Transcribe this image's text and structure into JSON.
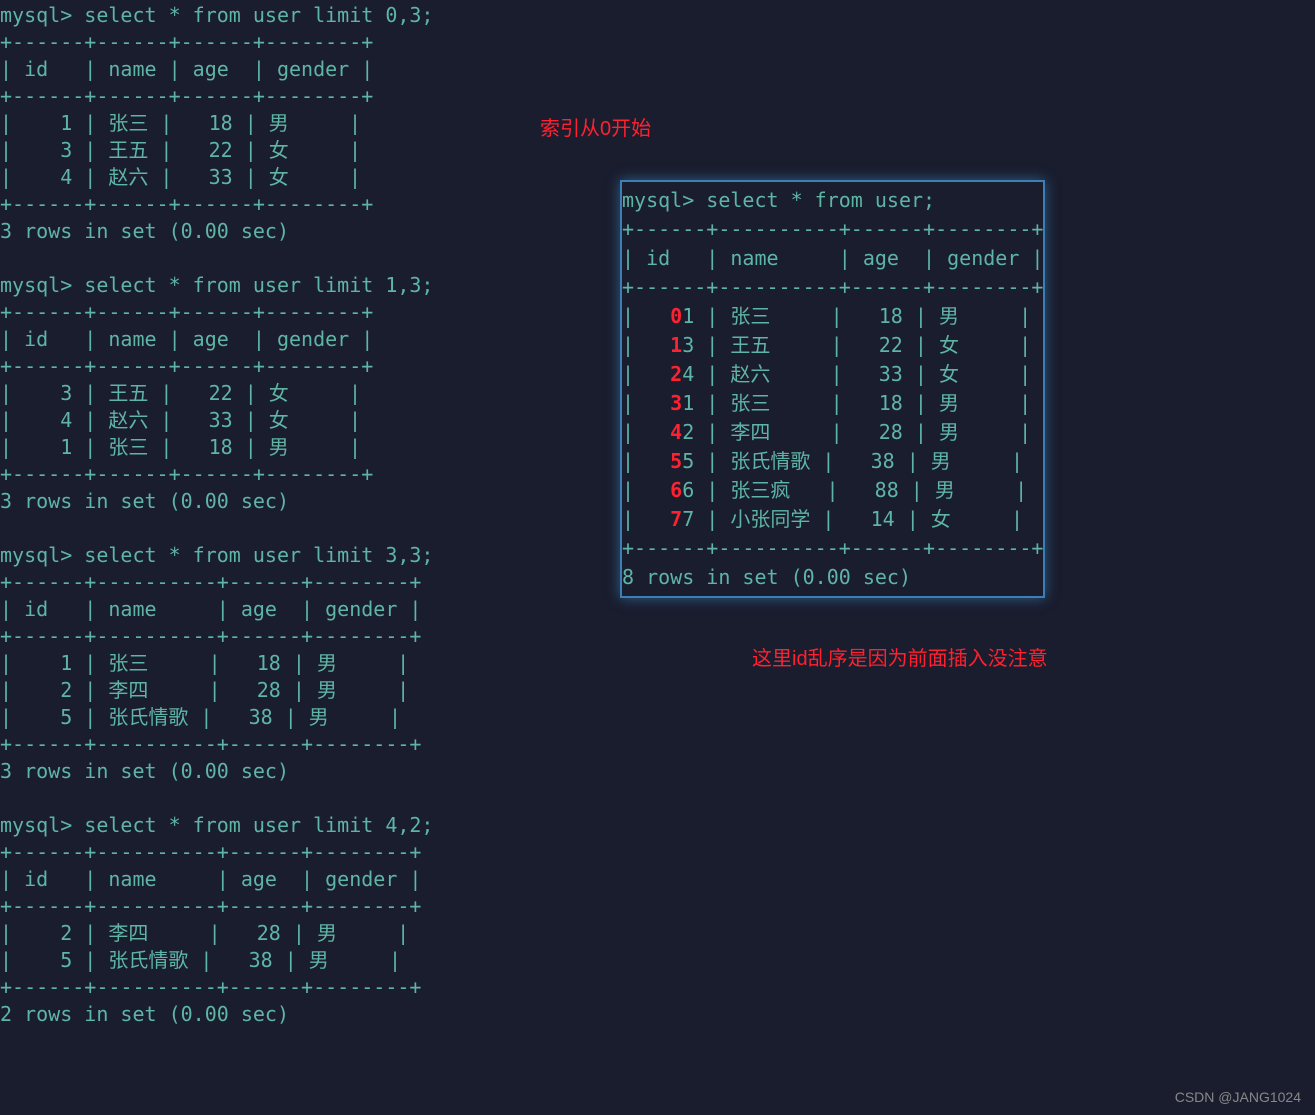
{
  "queries": [
    {
      "prompt": "mysql> ",
      "sql": "select * from user limit 0,3;",
      "sep": "+------+------+------+--------+",
      "header": "| id   | name | age  | gender |",
      "rows": [
        "|    1 | 张三 |   18 | 男     |",
        "|    3 | 王五 |   22 | 女     |",
        "|    4 | 赵六 |   33 | 女     |"
      ],
      "footer": "3 rows in set (0.00 sec)"
    },
    {
      "prompt": "mysql> ",
      "sql": "select * from user limit 1,3;",
      "sep": "+------+------+------+--------+",
      "header": "| id   | name | age  | gender |",
      "rows": [
        "|    3 | 王五 |   22 | 女     |",
        "|    4 | 赵六 |   33 | 女     |",
        "|    1 | 张三 |   18 | 男     |"
      ],
      "footer": "3 rows in set (0.00 sec)"
    },
    {
      "prompt": "mysql> ",
      "sql": "select * from user limit 3,3;",
      "sep": "+------+----------+------+--------+",
      "header": "| id   | name     | age  | gender |",
      "rows": [
        "|    1 | 张三     |   18 | 男     |",
        "|    2 | 李四     |   28 | 男     |",
        "|    5 | 张氏情歌 |   38 | 男     |"
      ],
      "footer": "3 rows in set (0.00 sec)"
    },
    {
      "prompt": "mysql> ",
      "sql": "select * from user limit 4,2;",
      "sep": "+------+----------+------+--------+",
      "header": "| id   | name     | age  | gender |",
      "rows": [
        "|    2 | 李四     |   28 | 男     |",
        "|    5 | 张氏情歌 |   38 | 男     |"
      ],
      "footer": "2 rows in set (0.00 sec)"
    }
  ],
  "right": {
    "prompt": "mysql> ",
    "sql": "select * from user;",
    "sep": "+------+----------+------+--------+",
    "header": "| id   | name     | age  | gender |",
    "rows": [
      {
        "idx": "0",
        "line": "|    1 | 张三     |   18 | 男     |"
      },
      {
        "idx": "1",
        "line": "|    3 | 王五     |   22 | 女     |"
      },
      {
        "idx": "2",
        "line": "|    4 | 赵六     |   33 | 女     |"
      },
      {
        "idx": "3",
        "line": "|    1 | 张三     |   18 | 男     |"
      },
      {
        "idx": "4",
        "line": "|    2 | 李四     |   28 | 男     |"
      },
      {
        "idx": "5",
        "line": "|    5 | 张氏情歌 |   38 | 男     |"
      },
      {
        "idx": "6",
        "line": "|    6 | 张三疯   |   88 | 男     |"
      },
      {
        "idx": "7",
        "line": "|    7 | 小张同学 |   14 | 女     |"
      }
    ],
    "footer": "8 rows in set (0.00 sec)"
  },
  "annotations": {
    "top": "索引从0开始",
    "bottom": "这里id乱序是因为前面插入没注意"
  },
  "watermark": "CSDN @JANG1024"
}
